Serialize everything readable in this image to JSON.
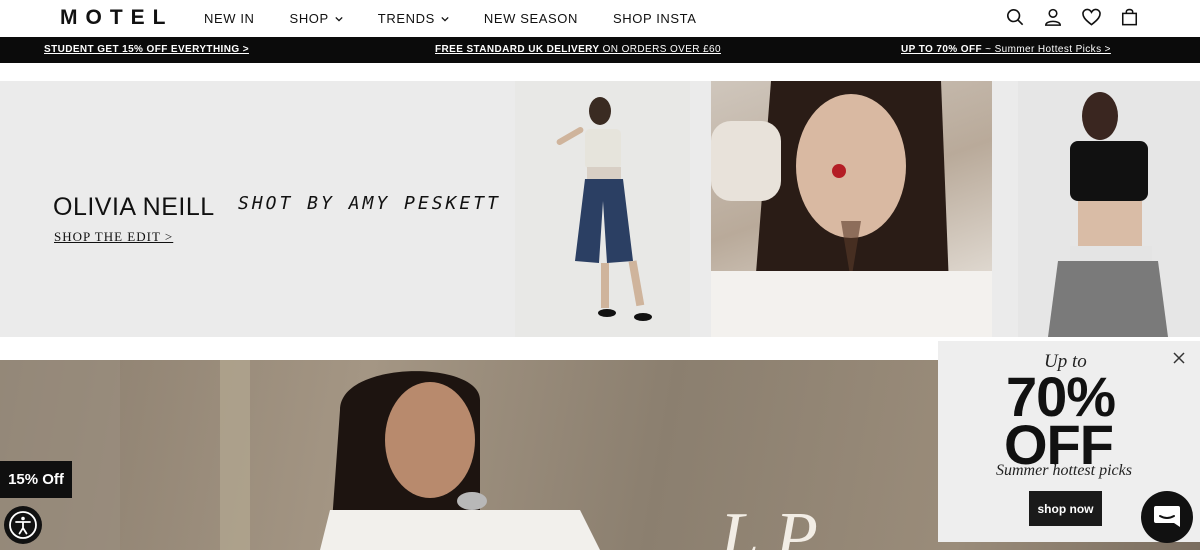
{
  "header": {
    "logo": "MOTEL",
    "nav": [
      {
        "label": "NEW IN",
        "has_dropdown": false
      },
      {
        "label": "SHOP",
        "has_dropdown": true
      },
      {
        "label": "TRENDS",
        "has_dropdown": true
      },
      {
        "label": "NEW SEASON",
        "has_dropdown": false
      },
      {
        "label": "SHOP INSTA",
        "has_dropdown": false
      }
    ],
    "icons": [
      "search-icon",
      "account-icon",
      "wishlist-heart-icon",
      "bag-icon"
    ]
  },
  "promo_bar": {
    "left": {
      "bold": "STUDENT GET 15% OFF EVERYTHING >",
      "light": ""
    },
    "center": {
      "bold": "FREE STANDARD UK DELIVERY",
      "light": " ON ORDERS OVER £60"
    },
    "right": {
      "bold": "UP TO 70% OFF",
      "light": " ~ Summer Hottest Picks >"
    }
  },
  "hero": {
    "title": "OLIVIA NEILL",
    "subtitle": "SHOT BY AMY PESKETT",
    "cta": "SHOP THE EDIT >"
  },
  "popup": {
    "up_to": "Up to",
    "percent": "70%",
    "off": "OFF",
    "subtitle": "Summer hottest picks",
    "button": "shop now"
  },
  "widgets": {
    "discount_tab": "15% Off"
  },
  "colors": {
    "promo_bg": "#0b0b0b",
    "hero_bg": "#ebebeb",
    "popup_bg": "#eeeeee",
    "button_bg": "#1a1a1a"
  }
}
